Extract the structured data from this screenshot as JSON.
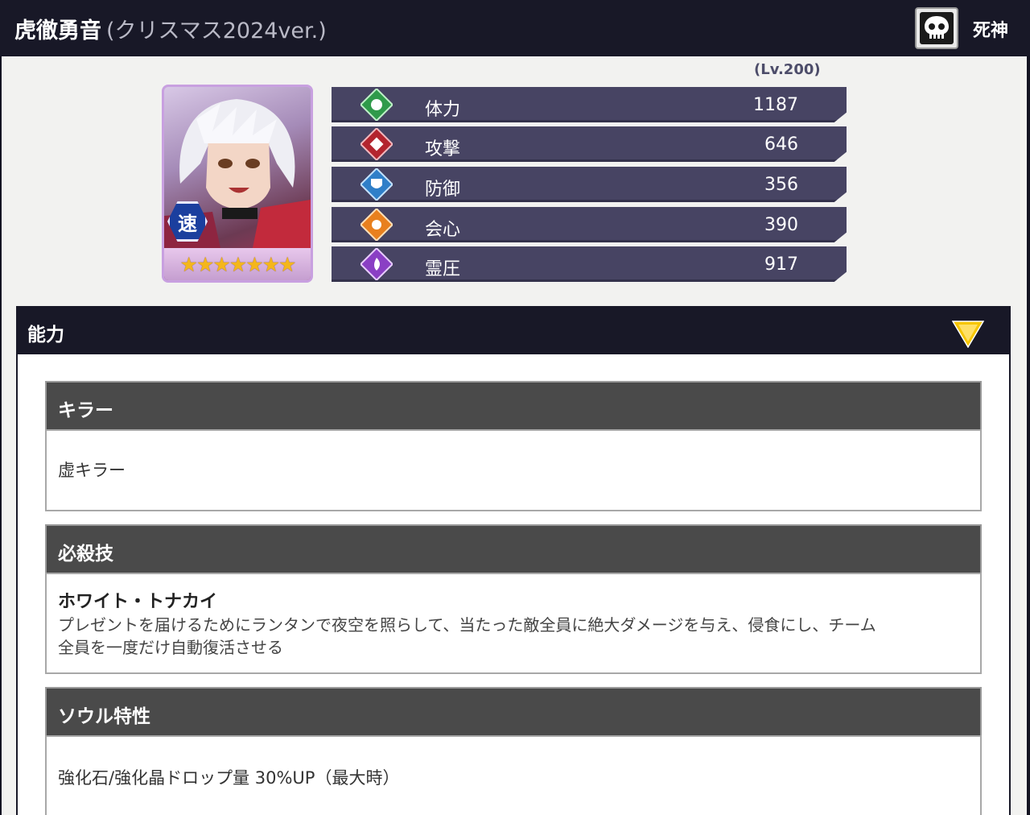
{
  "header": {
    "character_name": "虎徹勇音",
    "version": "(クリスマス2024ver.)",
    "attribute_label": "死神"
  },
  "level": "(Lv.200)",
  "portrait": {
    "badge_text": "速",
    "stars": "★★★★★★★",
    "star_count": 7
  },
  "stats": [
    {
      "name": "体力",
      "value": "1187",
      "color": "#2f9a4a",
      "icon": "leaf-icon"
    },
    {
      "name": "攻撃",
      "value": "646",
      "color": "#b3242e",
      "icon": "attack-icon"
    },
    {
      "name": "防御",
      "value": "356",
      "color": "#2f7fc8",
      "icon": "shield-icon"
    },
    {
      "name": "会心",
      "value": "390",
      "color": "#e8801e",
      "icon": "critical-icon"
    },
    {
      "name": "霊圧",
      "value": "917",
      "color": "#8a3fc4",
      "icon": "spirit-icon"
    }
  ],
  "ability": {
    "title": "能力",
    "sections": [
      {
        "heading": "キラー",
        "text": "虚キラー"
      },
      {
        "heading": "必殺技",
        "skill_name": "ホワイト・トナカイ",
        "description_line1": "プレゼントを届けるためにランタンで夜空を照らして、当たった敵全員に絶大ダメージを与え、侵食にし、チーム",
        "description_line2": "全員を一度だけ自動復活させる"
      },
      {
        "heading": "ソウル特性",
        "text": "強化石/強化晶ドロップ量 30%UP（最大時）"
      }
    ]
  }
}
